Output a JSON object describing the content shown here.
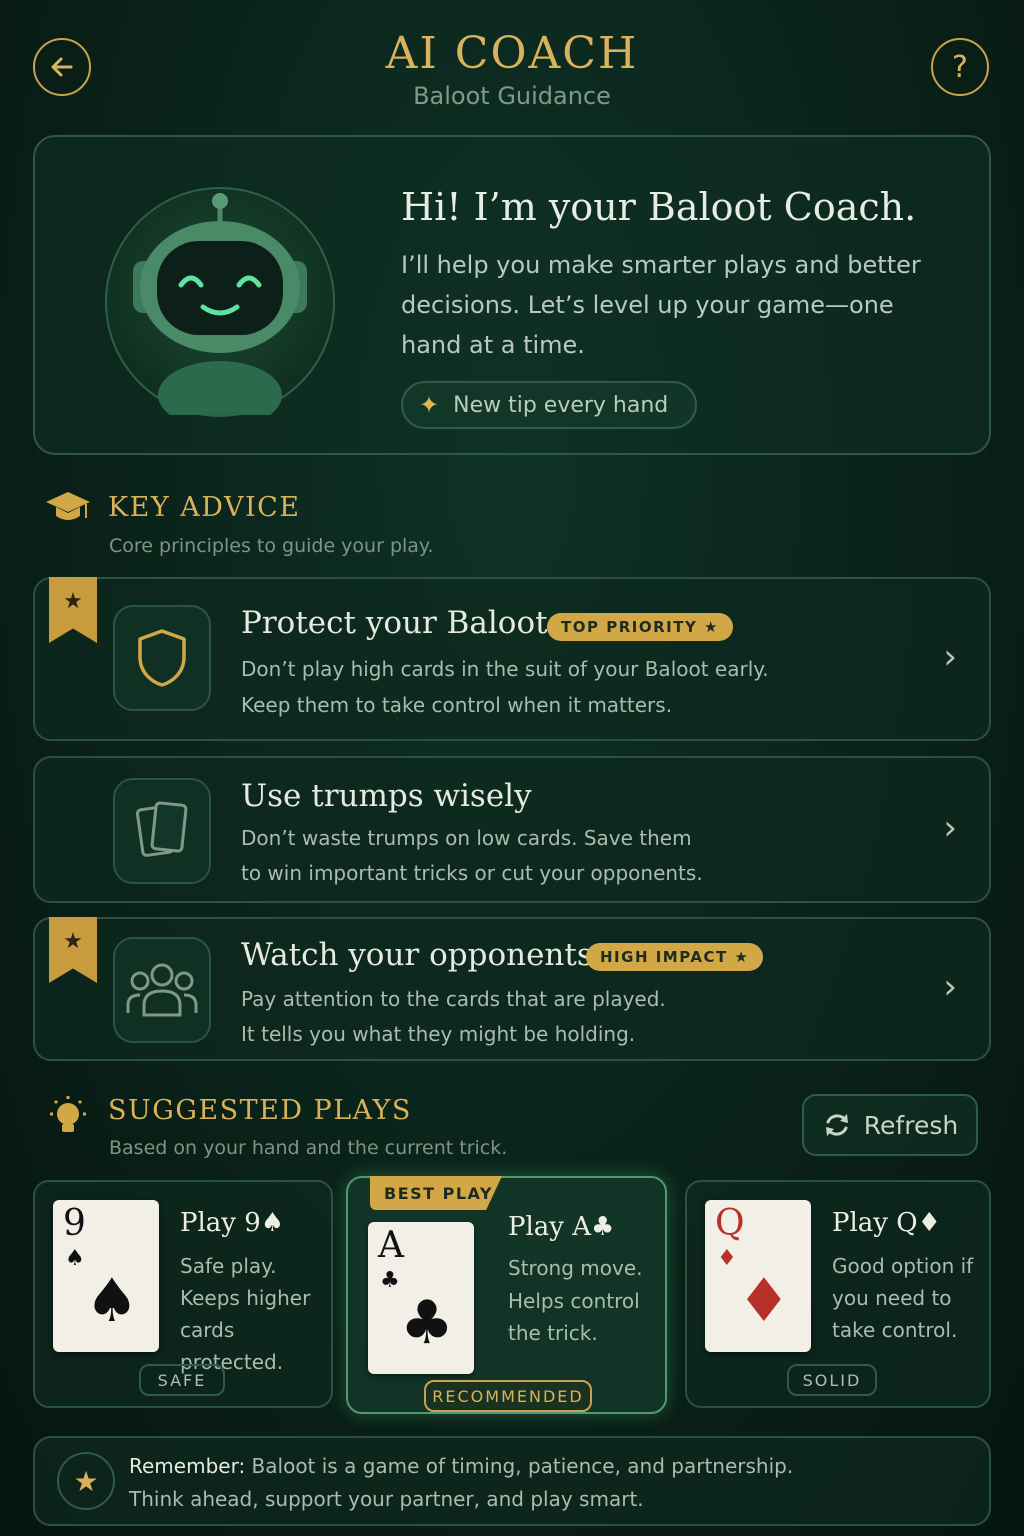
{
  "header": {
    "title": "AI COACH",
    "subtitle": "Baloot Guidance",
    "back_icon": "arrow-left-icon",
    "help_label": "?"
  },
  "hero": {
    "title": "Hi! I’m your Baloot Coach.",
    "text": "I’ll help you make smarter plays and better decisions. Let’s level up your game—one hand at a time.",
    "pill_label": "New tip every hand"
  },
  "key_advice": {
    "title": "KEY ADVICE",
    "subtitle": "Core principles to guide your play.",
    "items": [
      {
        "title": "Protect your Baloot",
        "badge": "TOP PRIORITY ★",
        "line1": "Don’t play high cards in the suit of your Baloot early.",
        "line2": "Keep them to take control when it matters.",
        "icon": "shield-icon"
      },
      {
        "title": "Use trumps wisely",
        "line1": "Don’t waste trumps on low cards. Save them",
        "line2": "to win important tricks or cut your opponents.",
        "icon": "cards-icon"
      },
      {
        "title": "Watch your opponents",
        "badge": "HIGH IMPACT ★",
        "line1": "Pay attention to the cards that are played.",
        "line2": "It tells you what they might be holding.",
        "icon": "group-icon"
      }
    ]
  },
  "suggested": {
    "title": "SUGGESTED PLAYS",
    "subtitle": "Based on your hand and the current trick.",
    "refresh_label": "Refresh",
    "best_label": "BEST PLAY",
    "plays": [
      {
        "rank": "9",
        "suit": "♠",
        "title": "Play 9♠",
        "line1": "Safe play.",
        "line2": "Keeps higher",
        "line3": "cards protected.",
        "tag": "SAFE"
      },
      {
        "rank": "A",
        "suit": "♣",
        "title": "Play A♣",
        "line1": "Strong move.",
        "line2": "Helps control",
        "line3": "the trick.",
        "tag": "RECOMMENDED"
      },
      {
        "rank": "Q",
        "suit": "♦",
        "title": "Play Q♦",
        "line1": "Good option if",
        "line2": "you need to",
        "line3": "take control.",
        "tag": "SOLID"
      }
    ]
  },
  "footer": {
    "lead": "Remember:",
    "line1": " Baloot is a game of timing, patience, and partnership.",
    "line2": "Think ahead, support your partner, and play smart."
  },
  "colors": {
    "accent_gold": "#d9b25a",
    "background": "#0a2219",
    "card_red": "#c0302a"
  }
}
